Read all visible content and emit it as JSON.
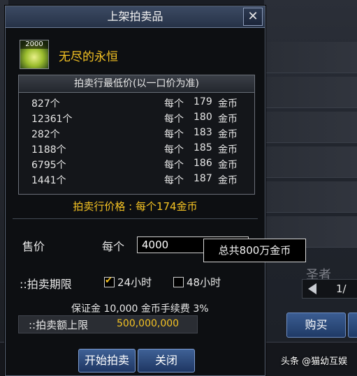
{
  "dialog": {
    "title": "上架拍卖品",
    "close_symbol": "✕"
  },
  "item": {
    "icon_count": "2000",
    "name": "无尽的永恒"
  },
  "lowest_prices": {
    "header": "拍卖行最低价(以一口价为准)",
    "rows": [
      {
        "qty": "827个",
        "each": "每个",
        "price": "179",
        "unit": "金币"
      },
      {
        "qty": "12361个",
        "each": "每个",
        "price": "180",
        "unit": "金币"
      },
      {
        "qty": "282个",
        "each": "每个",
        "price": "183",
        "unit": "金币"
      },
      {
        "qty": "1188个",
        "each": "每个",
        "price": "185",
        "unit": "金币"
      },
      {
        "qty": "6795个",
        "each": "每个",
        "price": "186",
        "unit": "金币"
      },
      {
        "qty": "1441个",
        "each": "每个",
        "price": "187",
        "unit": "金币"
      }
    ]
  },
  "reference_price": "拍卖行价格 : 每个174金币",
  "sell": {
    "label": "售价",
    "each_label": "每个",
    "value": "4000",
    "total_tooltip": "总共800万金币"
  },
  "duration": {
    "label": "::拍卖期限",
    "options": [
      {
        "label": "24小时",
        "checked": true
      },
      {
        "label": "48小时",
        "checked": false
      }
    ]
  },
  "fee_text": "保证金 10,000 金币手续费 3%",
  "limit": {
    "label": "::拍卖额上限",
    "value": "500,000,000"
  },
  "buttons": {
    "start": "开始拍卖",
    "close": "关闭"
  },
  "background": {
    "pager": "1/",
    "buy_label": "购买",
    "elder_text": "圣者",
    "watermark": "头条 @猫幼互娱"
  }
}
